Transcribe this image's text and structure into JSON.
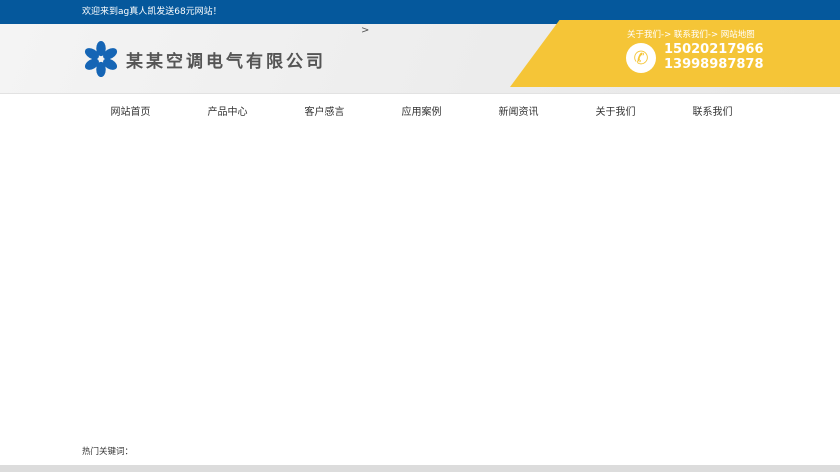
{
  "topbar": {
    "welcome": "欢迎来到ag真人凯发送68元网站！"
  },
  "header": {
    "arrow": ">",
    "company": "某某空调电气有限公司",
    "links": "关于我们-> 联系我们-> 网站地图",
    "phones": [
      "15020217966",
      "13998987878"
    ],
    "accent": "#f5c537",
    "brand": "#05589c"
  },
  "nav": [
    "网站首页",
    "产品中心",
    "客户感言",
    "应用案例",
    "新闻资讯",
    "关于我们",
    "联系我们"
  ],
  "footer": {
    "keywords_label": "热门关键词："
  }
}
